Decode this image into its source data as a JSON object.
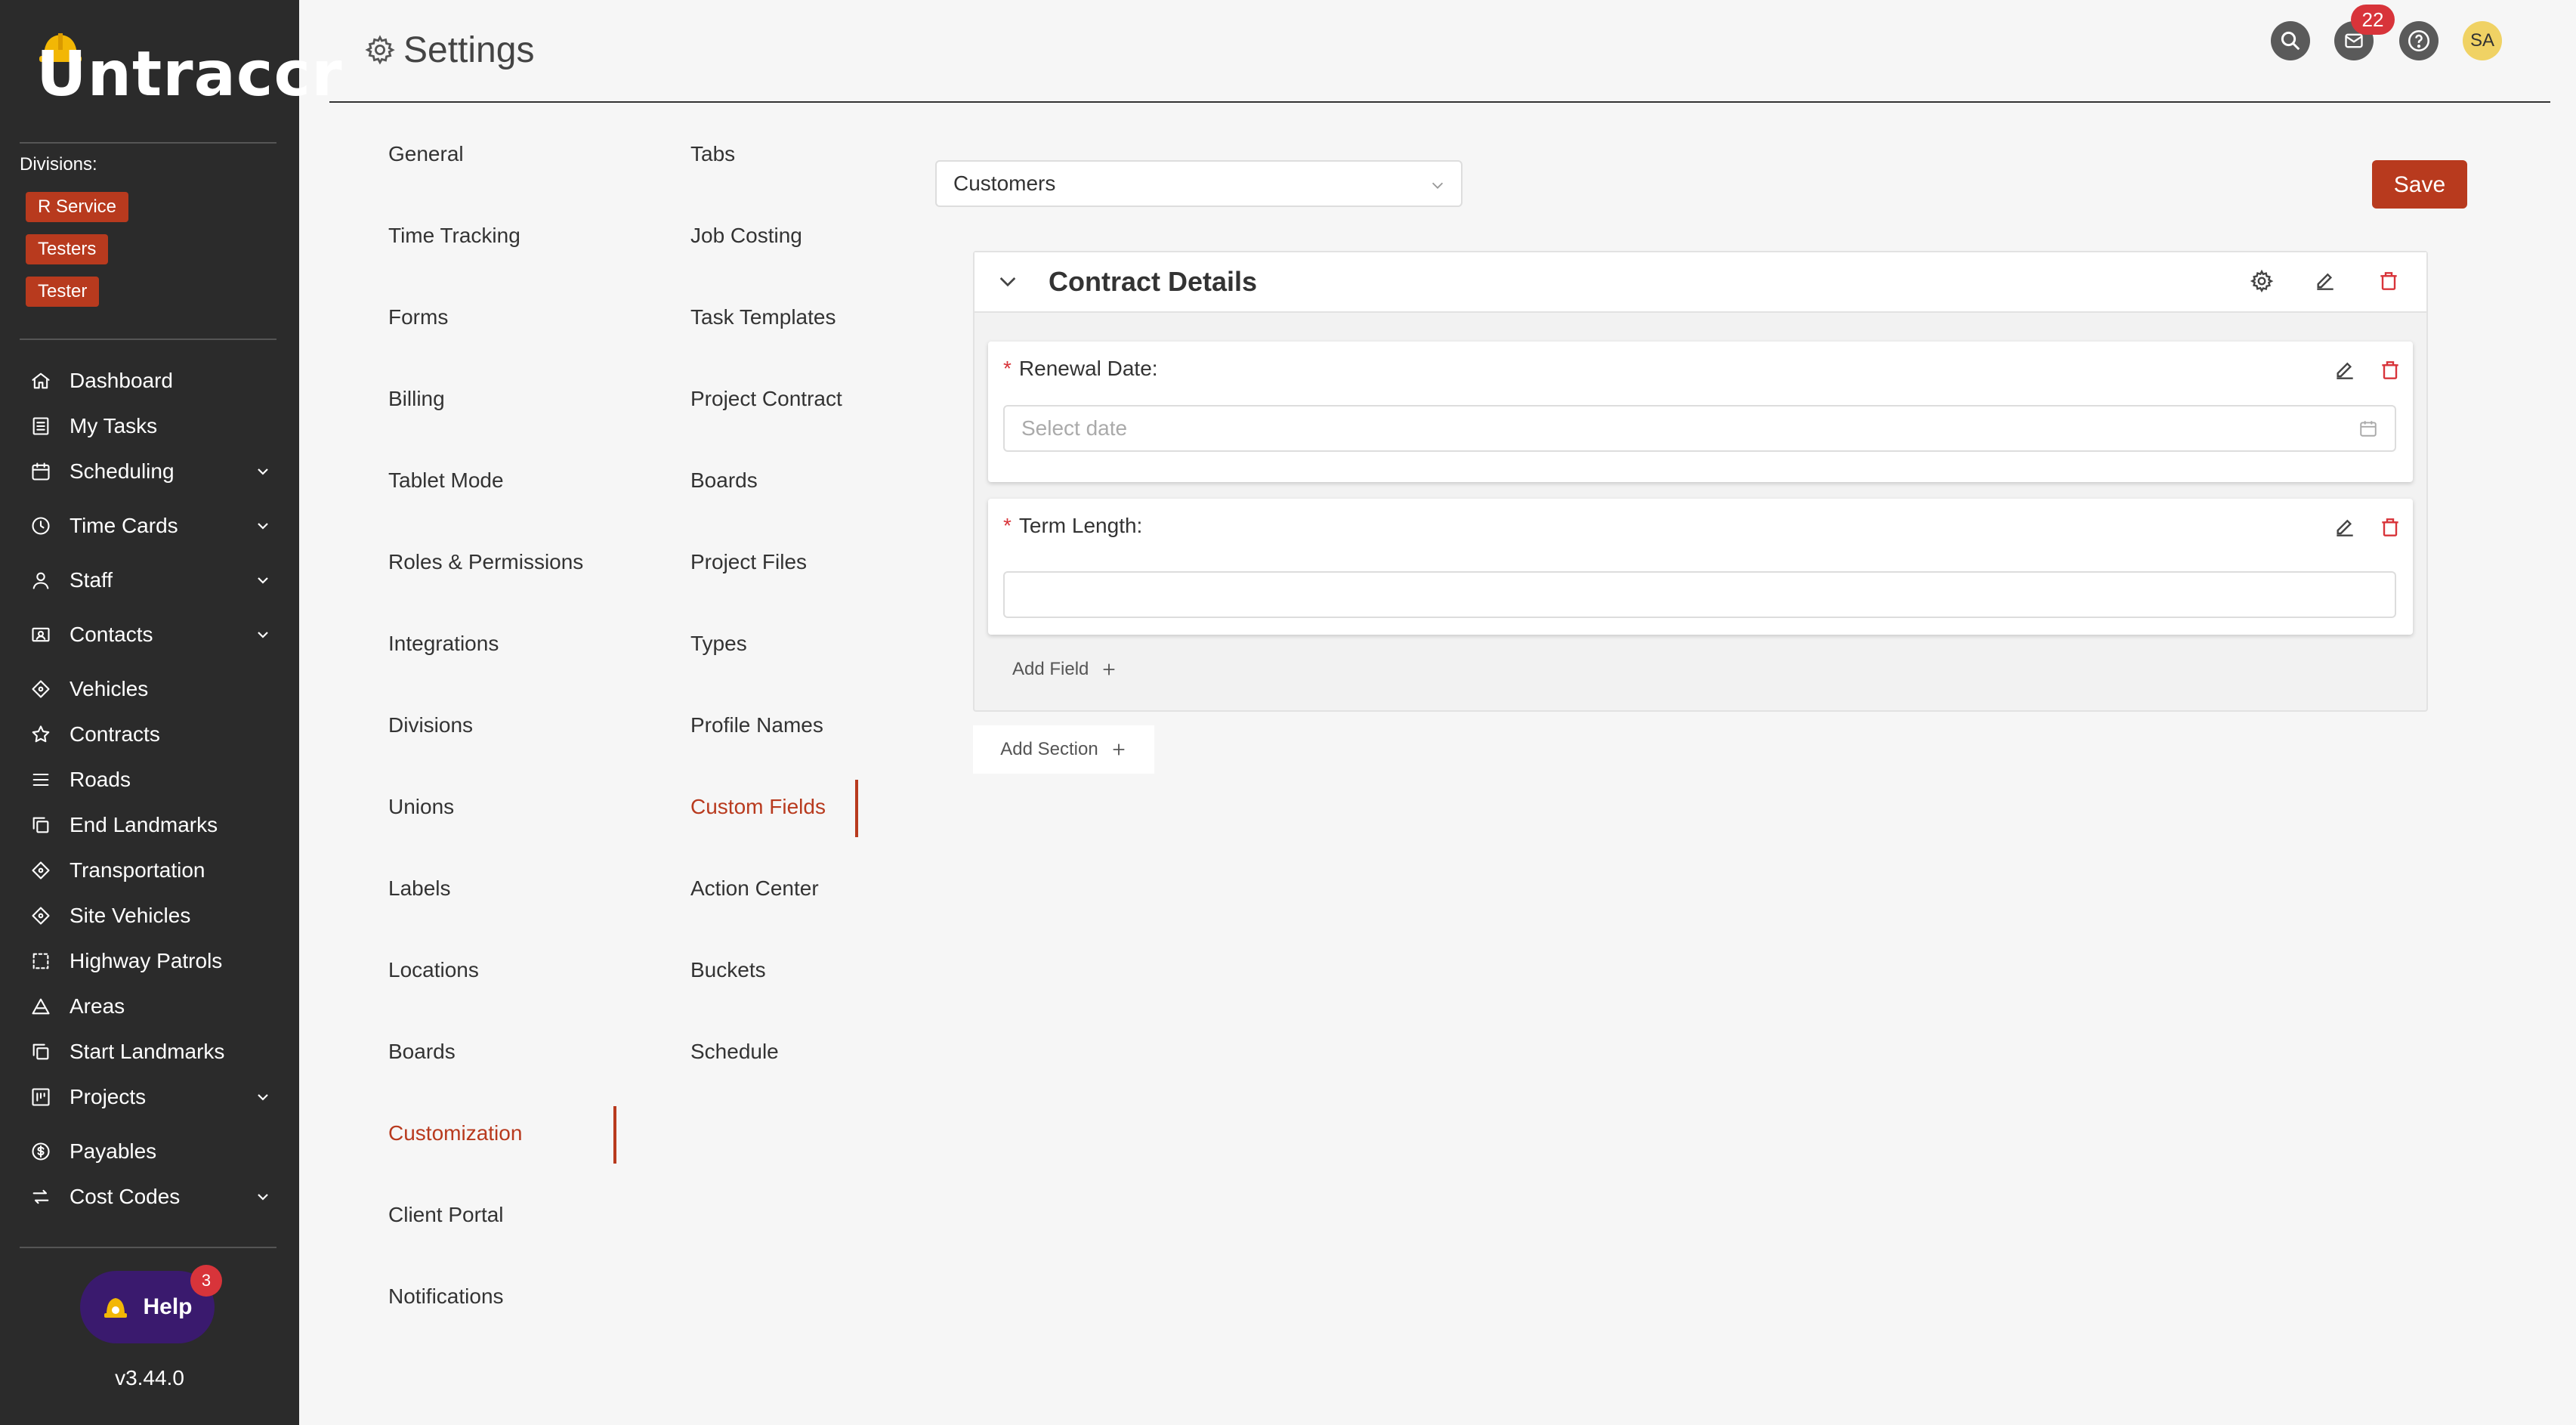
{
  "app": {
    "logo_text": "Untraccr",
    "version": "v3.44.0"
  },
  "sidebar": {
    "divisions_label": "Divisions:",
    "divisions": [
      "R Service",
      "Testers",
      "Tester"
    ],
    "items": [
      {
        "label": "Dashboard",
        "icon": "home-icon",
        "has_chevron": false
      },
      {
        "label": "My Tasks",
        "icon": "list-icon",
        "has_chevron": false
      },
      {
        "label": "Scheduling",
        "icon": "calendar-icon",
        "has_chevron": true
      },
      {
        "label": "Time Cards",
        "icon": "clock-icon",
        "has_chevron": true
      },
      {
        "label": "Staff",
        "icon": "user-icon",
        "has_chevron": true
      },
      {
        "label": "Contacts",
        "icon": "contact-card-icon",
        "has_chevron": true
      },
      {
        "label": "Vehicles",
        "icon": "diamond-icon",
        "has_chevron": false
      },
      {
        "label": "Contracts",
        "icon": "star-icon",
        "has_chevron": false
      },
      {
        "label": "Roads",
        "icon": "lines-icon",
        "has_chevron": false
      },
      {
        "label": "End Landmarks",
        "icon": "copy-icon",
        "has_chevron": false
      },
      {
        "label": "Transportation",
        "icon": "diamond-icon",
        "has_chevron": false
      },
      {
        "label": "Site Vehicles",
        "icon": "diamond-icon",
        "has_chevron": false
      },
      {
        "label": "Highway Patrols",
        "icon": "dashed-square-icon",
        "has_chevron": false
      },
      {
        "label": "Areas",
        "icon": "triangle-icon",
        "has_chevron": false
      },
      {
        "label": "Start Landmarks",
        "icon": "copy-icon",
        "has_chevron": false
      },
      {
        "label": "Projects",
        "icon": "project-icon",
        "has_chevron": true
      },
      {
        "label": "Payables",
        "icon": "dollar-icon",
        "has_chevron": false
      },
      {
        "label": "Cost Codes",
        "icon": "swap-icon",
        "has_chevron": true
      }
    ],
    "help": {
      "label": "Help",
      "badge": "3"
    }
  },
  "header": {
    "title": "Settings",
    "notification_count": "22",
    "avatar_initials": "SA"
  },
  "settings_menu": {
    "col1": [
      "General",
      "Time Tracking",
      "Forms",
      "Billing",
      "Tablet Mode",
      "Roles & Permissions",
      "Integrations",
      "Divisions",
      "Unions",
      "Labels",
      "Locations",
      "Boards",
      "Customization",
      "Client Portal",
      "Notifications"
    ],
    "col1_active": "Customization",
    "col2": [
      "Tabs",
      "Job Costing",
      "Task Templates",
      "Project Contract",
      "Boards",
      "Project Files",
      "Types",
      "Profile Names",
      "Custom Fields",
      "Action Center",
      "Buckets",
      "Schedule"
    ],
    "col2_active": "Custom Fields"
  },
  "main": {
    "entity_select": {
      "value": "Customers"
    },
    "save_label": "Save",
    "section": {
      "title": "Contract Details",
      "fields": [
        {
          "label": "Renewal Date:",
          "required": true,
          "placeholder": "Select date",
          "type": "date"
        },
        {
          "label": "Term Length:",
          "required": true,
          "placeholder": "",
          "type": "text"
        }
      ],
      "add_field_label": "Add Field"
    },
    "add_section_label": "Add Section"
  },
  "colors": {
    "accent": "#b83a1e",
    "sidebar_bg": "#2b2b2b",
    "badge_red": "#d8343a"
  }
}
